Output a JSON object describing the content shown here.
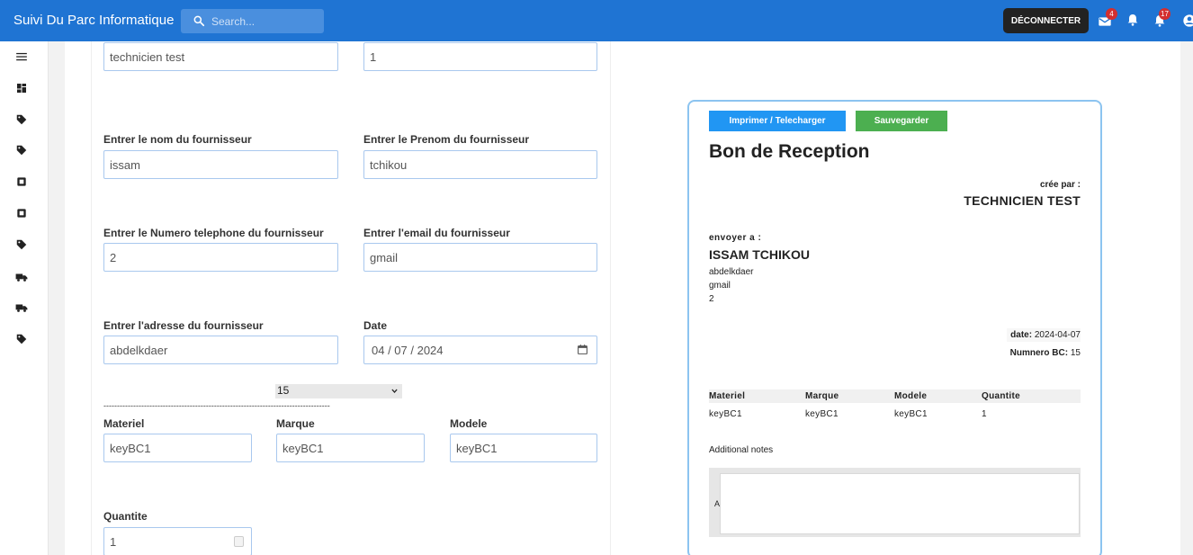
{
  "app": {
    "title": "Suivi Du Parc Informatique"
  },
  "search": {
    "placeholder": "Search..."
  },
  "topbar": {
    "logout_label": "DÉCONNECTER",
    "mail_badge": "4",
    "notif_badge": "17"
  },
  "form": {
    "top_left_value": "technicien test",
    "top_right_value": "1",
    "supplier_lastname_label": "Entrer le nom du fournisseur",
    "supplier_lastname_value": "issam",
    "supplier_firstname_label": "Entrer le Prenom du fournisseur",
    "supplier_firstname_value": "tchikou",
    "supplier_phone_label": "Entrer le Numero telephone du fournisseur",
    "supplier_phone_value": "2",
    "supplier_email_label": "Entrer l'email du fournisseur",
    "supplier_email_value": "gmail",
    "supplier_address_label": "Entrer l'adresse du fournisseur",
    "supplier_address_value": "abdelkdaer",
    "date_label": "Date",
    "date_value": "04 / 07 / 2024",
    "bc_select_value": "15",
    "separator": "------------------------------------------------------------------------------------",
    "materiel_label": "Materiel",
    "materiel_value": "keyBC1",
    "marque_label": "Marque",
    "marque_value": "keyBC1",
    "modele_label": "Modele",
    "modele_value": "keyBC1",
    "quantite_label": "Quantite",
    "quantite_value": "1"
  },
  "receipt": {
    "print_label": "Imprimer / Telecharger",
    "save_label": "Sauvegarder",
    "title": "Bon de Reception",
    "created_by_label": "crée par :",
    "created_by_value": "TECHNICIEN TEST",
    "sent_to_label": "envoyer a :",
    "recipient_name": "ISSAM TCHIKOU",
    "recipient_address": "abdelkdaer",
    "recipient_email": "gmail",
    "recipient_phone": "2",
    "date_key": "date:",
    "date_value": "2024-04-07",
    "bc_key": "Numnero BC:",
    "bc_value": "15",
    "table": {
      "headers": [
        "Materiel",
        "Marque",
        "Modele",
        "Quantite"
      ],
      "rows": [
        [
          "keyBC1",
          "keyBC1",
          "keyBC1",
          "1"
        ]
      ]
    },
    "notes_label": "Additional notes",
    "notes_letter": "A"
  },
  "icons": {
    "sidebar": [
      "menu-icon",
      "dashboard-icon",
      "tag-icon",
      "tag-icon",
      "chip-icon",
      "chip-icon",
      "tag-icon",
      "truck-icon",
      "truck-icon",
      "tag-icon"
    ],
    "topbar": [
      "search-icon",
      "mail-icon",
      "bell-icon",
      "notifications-icon",
      "account-icon"
    ]
  },
  "colors": {
    "topbar": "#1f74d3",
    "print_button": "#2196f3",
    "save_button": "#4caf50",
    "badge": "#d32f2f",
    "input_border": "#a9c8ee",
    "card_border": "#8cc4f0"
  }
}
